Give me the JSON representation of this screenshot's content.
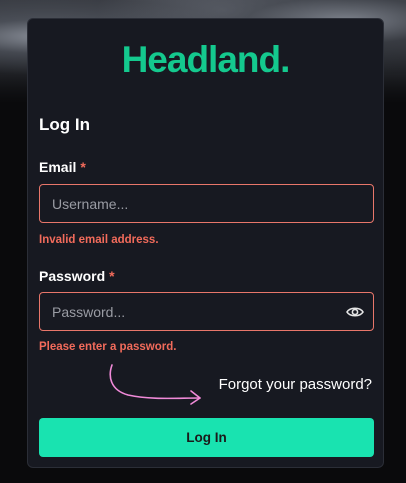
{
  "brand": {
    "logo_text": "Headland.",
    "accent_color": "#14c98e"
  },
  "form": {
    "heading": "Log In",
    "email": {
      "label": "Email",
      "required_marker": "*",
      "placeholder": "Username...",
      "value": "",
      "error": "Invalid email address."
    },
    "password": {
      "label": "Password",
      "required_marker": "*",
      "placeholder": "Password...",
      "value": "",
      "error": "Please enter a password.",
      "toggle_icon": "eye-icon"
    },
    "forgot_link": "Forgot your password?",
    "submit_label": "Log In"
  },
  "colors": {
    "error": "#f26b5b",
    "button": "#19e3b0",
    "card": "#171921",
    "annotation_arrow": "#f08ad8"
  }
}
